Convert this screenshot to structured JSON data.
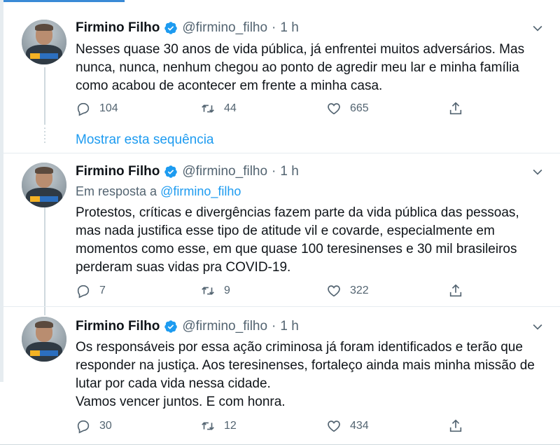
{
  "colors": {
    "accent": "#1d9bf0",
    "text": "#0f1419",
    "muted": "#536471",
    "border": "#e6ecf0"
  },
  "icons": {
    "reply": "reply-icon",
    "retweet": "retweet-icon",
    "like": "heart-icon",
    "share": "share-icon",
    "verified": "verified-badge-icon",
    "menu": "chevron-down-icon"
  },
  "show_thread": "Mostrar esta sequência",
  "tweets": [
    {
      "name": "Firmino Filho",
      "handle": "@firmino_filho",
      "dot": "·",
      "time": "1 h",
      "reply_prefix": "",
      "reply_handle": "",
      "lines": [
        "Nesses quase 30 anos de vida pública, já enfrentei muitos adversários. Mas",
        "nunca, nunca, nenhum chegou ao ponto de agredir meu lar e minha família",
        "como acabou de acontecer em frente a minha casa."
      ],
      "replies": "104",
      "retweets": "44",
      "likes": "665"
    },
    {
      "name": "Firmino Filho",
      "handle": "@firmino_filho",
      "dot": "·",
      "time": "1 h",
      "reply_prefix": "Em resposta a ",
      "reply_handle": "@firmino_filho",
      "lines": [
        "Protestos, críticas e divergências fazem parte da vida pública das pessoas,",
        "mas nada justifica esse tipo de atitude vil e covarde, especialmente em",
        "momentos como esse, em que quase 100 teresinenses e 30 mil brasileiros",
        "perderam suas vidas pra COVID-19."
      ],
      "replies": "7",
      "retweets": "9",
      "likes": "322"
    },
    {
      "name": "Firmino Filho",
      "handle": "@firmino_filho",
      "dot": "·",
      "time": "1 h",
      "reply_prefix": "",
      "reply_handle": "",
      "lines": [
        "Os responsáveis por essa ação criminosa já foram identificados e terão que",
        "responder na justiça. Aos teresinenses, fortaleço ainda mais minha missão de",
        "lutar por cada vida nessa cidade.",
        "Vamos vencer juntos. E com honra."
      ],
      "replies": "30",
      "retweets": "12",
      "likes": "434"
    }
  ]
}
